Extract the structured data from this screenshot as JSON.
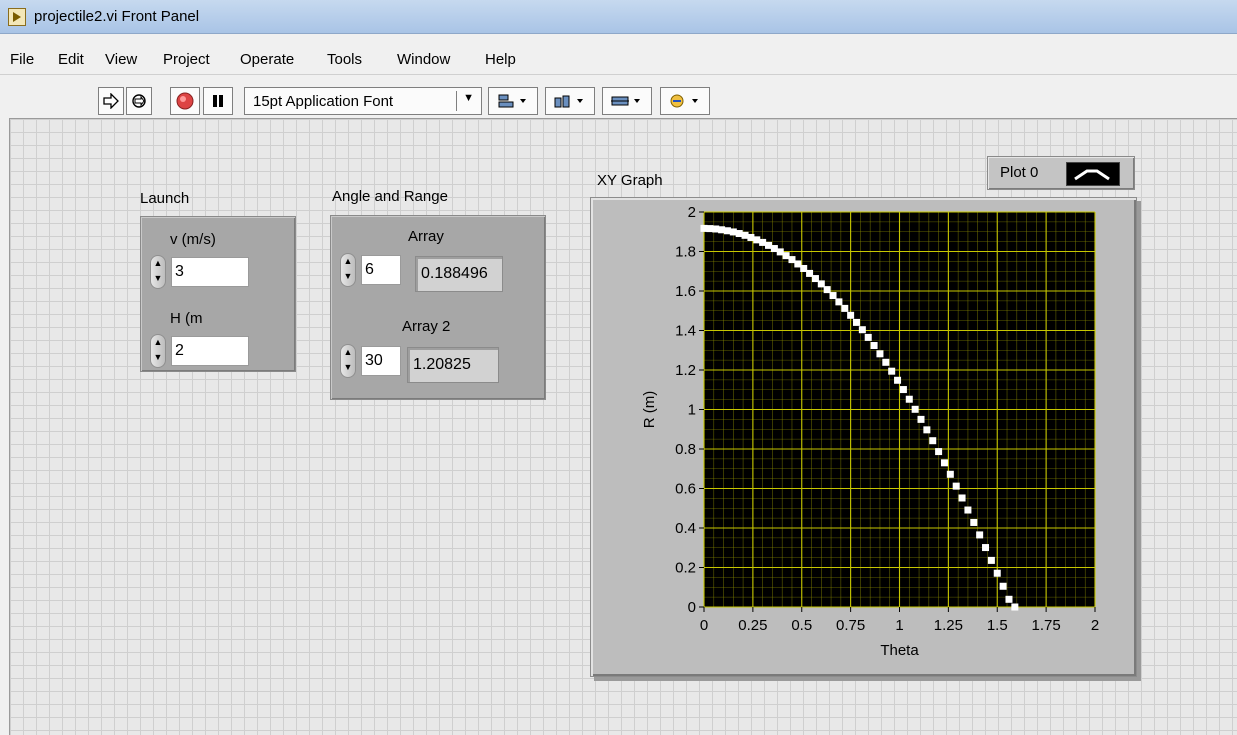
{
  "window": {
    "title": "projectile2.vi Front Panel"
  },
  "menu": [
    "File",
    "Edit",
    "View",
    "Project",
    "Operate",
    "Tools",
    "Window",
    "Help"
  ],
  "toolbar": {
    "font_label": "15pt Application Font"
  },
  "launch": {
    "title": "Launch",
    "v_label": "v (m/s)",
    "v_value": "3",
    "h_label": "H (m",
    "h_value": "2"
  },
  "angle_range": {
    "title": "Angle and Range",
    "array_label": "Array",
    "array_index": "6",
    "array_value": "0.188496",
    "array2_label": "Array 2",
    "array2_index": "30",
    "array2_value": "1.20825"
  },
  "graph": {
    "title": "XY Graph",
    "legend_label": "Plot 0",
    "plot_bg": "#000000",
    "grid_color": "#8a8a00",
    "trace_color": "#ffffff"
  },
  "chart_data": {
    "type": "scatter",
    "title": "XY Graph",
    "xlabel": "Theta",
    "ylabel": "R (m)",
    "xlim": [
      0,
      2
    ],
    "ylim": [
      0,
      2
    ],
    "x_ticks": [
      "0",
      "0.25",
      "0.5",
      "0.75",
      "1",
      "1.25",
      "1.5",
      "1.75",
      "2"
    ],
    "y_ticks": [
      "0",
      "0.2",
      "0.4",
      "0.6",
      "0.8",
      "1",
      "1.2",
      "1.4",
      "1.6",
      "1.8",
      "2"
    ],
    "grid": true,
    "series": [
      {
        "name": "Plot 0",
        "x": [
          0.0,
          0.03,
          0.06,
          0.09,
          0.12,
          0.15,
          0.18,
          0.21,
          0.24,
          0.27,
          0.3,
          0.33,
          0.36,
          0.39,
          0.42,
          0.45,
          0.48,
          0.51,
          0.54,
          0.57,
          0.6,
          0.63,
          0.66,
          0.69,
          0.72,
          0.75,
          0.78,
          0.81,
          0.84,
          0.87,
          0.9,
          0.93,
          0.96,
          0.99,
          1.02,
          1.05,
          1.08,
          1.11,
          1.14,
          1.17,
          1.2,
          1.23,
          1.26,
          1.29,
          1.32,
          1.35,
          1.38,
          1.41,
          1.44,
          1.47,
          1.5,
          1.53,
          1.56,
          1.59
        ],
        "y": [
          1.917,
          1.916,
          1.914,
          1.91,
          1.905,
          1.899,
          1.891,
          1.882,
          1.871,
          1.859,
          1.846,
          1.831,
          1.815,
          1.798,
          1.779,
          1.759,
          1.737,
          1.714,
          1.689,
          1.663,
          1.636,
          1.607,
          1.577,
          1.545,
          1.512,
          1.477,
          1.441,
          1.404,
          1.365,
          1.324,
          1.282,
          1.239,
          1.194,
          1.148,
          1.101,
          1.052,
          1.001,
          0.95,
          0.897,
          0.842,
          0.787,
          0.73,
          0.672,
          0.612,
          0.552,
          0.491,
          0.428,
          0.365,
          0.301,
          0.236,
          0.171,
          0.105,
          0.039,
          0.0
        ]
      }
    ]
  }
}
